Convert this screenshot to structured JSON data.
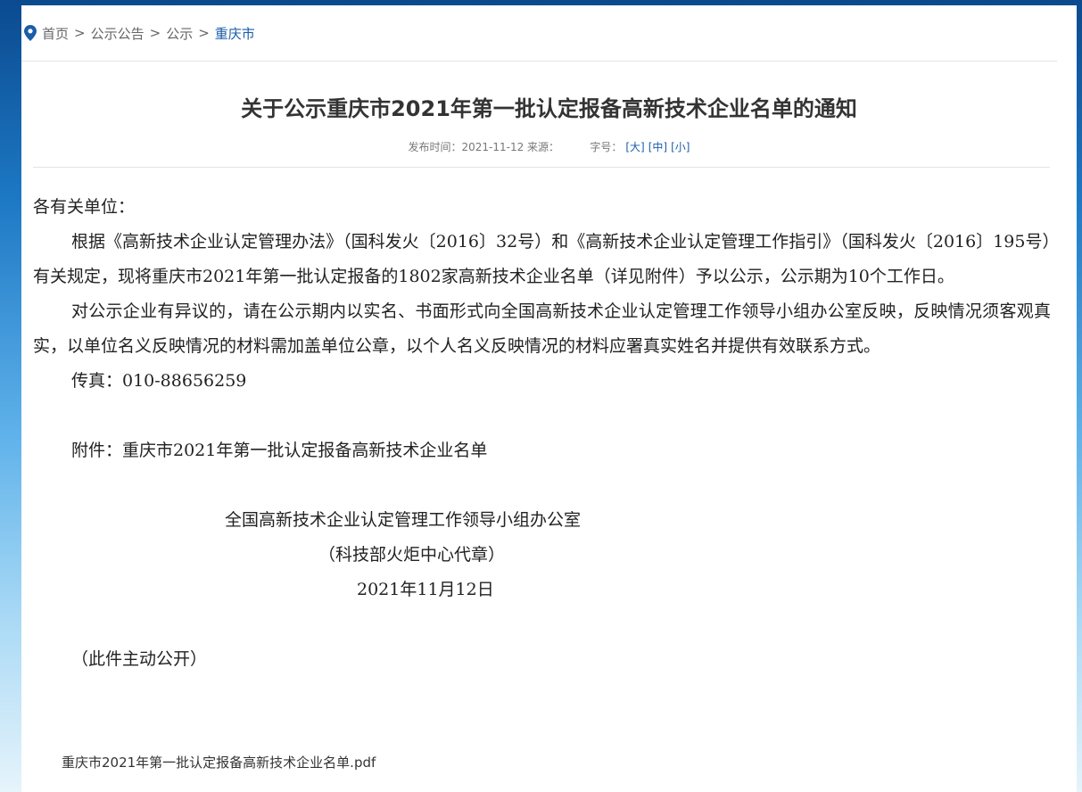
{
  "breadcrumb": {
    "items": [
      "首页",
      "公示公告",
      "公示"
    ],
    "separator": ">",
    "current": "重庆市"
  },
  "article": {
    "title": "关于公示重庆市2021年第一批认定报备高新技术企业名单的通知",
    "meta_text": "发布时间：2021-11-12 来源：         字号：",
    "font_sizes": [
      "[大]",
      "[中]",
      "[小]"
    ],
    "salutation": "各有关单位：",
    "para1": "根据《高新技术企业认定管理办法》（国科发火〔2016〕32号）和《高新技术企业认定管理工作指引》（国科发火〔2016〕195号）有关规定，现将重庆市2021年第一批认定报备的1802家高新技术企业名单（详见附件）予以公示，公示期为10个工作日。",
    "para2": "对公示企业有异议的，请在公示期内以实名、书面形式向全国高新技术企业认定管理工作领导小组办公室反映，反映情况须客观真实，以单位名义反映情况的材料需加盖单位公章，以个人名义反映情况的材料应署真实姓名并提供有效联系方式。",
    "fax": "传真：010-88656259",
    "attachment_note": "附件：重庆市2021年第一批认定报备高新技术企业名单",
    "signature_org": "全国高新技术企业认定管理工作领导小组办公室",
    "signature_sub": "（科技部火炬中心代章）",
    "signature_date": "2021年11月12日",
    "public_note": "（此件主动公开）",
    "attachment_file": "重庆市2021年第一批认定报备高新技术企业名单.pdf"
  },
  "colors": {
    "link": "#1b5da8",
    "pin_icon": "#1b5da8"
  },
  "icons": {
    "breadcrumb": "location-pin-icon"
  }
}
